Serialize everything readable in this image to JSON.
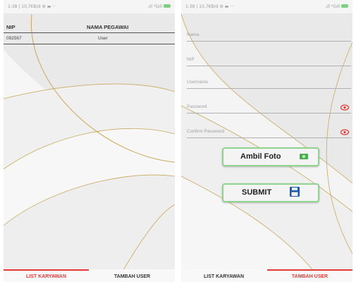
{
  "status_bar": {
    "time": "1:38 | 10,7KB/d ⚙ ▬ ···",
    "signal": ".ıll ⁴Gıll"
  },
  "list_screen": {
    "header": {
      "nip": "NIP",
      "nama": "NAMA PEGAWAI"
    },
    "rows": [
      {
        "nip": "092567",
        "nama": "User"
      }
    ]
  },
  "form_screen": {
    "fields": {
      "nama": "Nama",
      "nip": "NIP",
      "username": "Username",
      "password": "Password",
      "confirm_password": "Confirm Password"
    },
    "ambil_foto_label": "Ambil Foto",
    "submit_label": "SUBMIT"
  },
  "tabs": {
    "list": "LIST KARYAWAN",
    "add": "TAMBAH USER"
  },
  "colors": {
    "accent": "#e53935",
    "button_border": "#8fd48f",
    "gold_line": "#c9a85b"
  },
  "icons": {
    "eye": "eye-icon",
    "camera": "camera-icon",
    "save": "floppy-disk-icon"
  }
}
